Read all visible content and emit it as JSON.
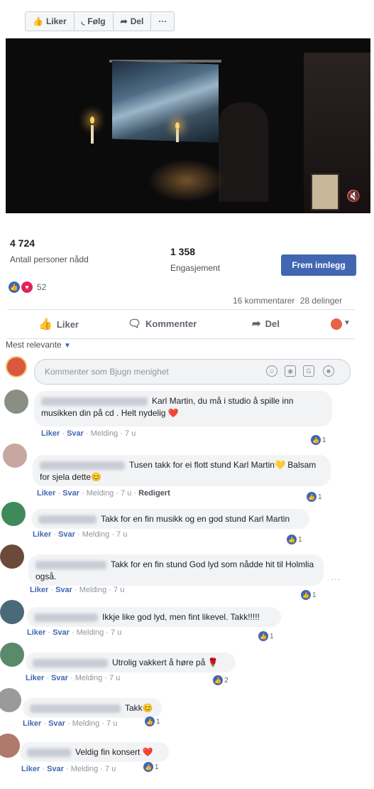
{
  "toolbar": {
    "like": "Liker",
    "follow": "Følg",
    "share": "Del",
    "more": "···"
  },
  "video": {
    "mute_icon": "speaker-muted-icon"
  },
  "stats": {
    "reach_num": "4 724",
    "reach_label": "Antall personer nådd",
    "eng_num": "1 358",
    "eng_label": "Engasjement",
    "boost": "Frem innlegg"
  },
  "reactions": {
    "count": "52",
    "comments": "16 kommentarer",
    "shares": "28 delinger"
  },
  "actions": {
    "like": "Liker",
    "comment": "Kommenter",
    "share": "Del"
  },
  "sort": {
    "label": "Mest relevante"
  },
  "composer": {
    "placeholder": "Kommenter som Bjugn menighet"
  },
  "comments": [
    {
      "text": "Karl Martin, du må i studio å spille inn musikken din på cd . Helt nydelig",
      "emoji": "❤️",
      "meta_like": "Liker",
      "meta_reply": "Svar",
      "meta_msg": "Melding",
      "time": "7 u",
      "extra": "",
      "rcount": "1"
    },
    {
      "text": "Tusen takk for ei flott stund Karl Martin",
      "emoji": "💛",
      "text2": "Balsam for sjela dette",
      "emoji2": "😊",
      "meta_like": "Liker",
      "meta_reply": "Svar",
      "meta_msg": "Melding",
      "time": "7 u",
      "extra": "Redigert",
      "rcount": "1"
    },
    {
      "text": "Takk for en fin musikk og en god stund Karl Martin",
      "meta_like": "Liker",
      "meta_reply": "Svar",
      "meta_msg": "Melding",
      "time": "7 u",
      "rcount": "1"
    },
    {
      "text": "Takk for en fin stund God lyd som nådde hit til Holmlia også.",
      "meta_like": "Liker",
      "meta_reply": "Svar",
      "meta_msg": "Melding",
      "time": "7 u",
      "rcount": "1"
    },
    {
      "text": "Ikkje like god lyd, men fint likevel. Takk!!!!!",
      "meta_like": "Liker",
      "meta_reply": "Svar",
      "meta_msg": "Melding",
      "time": "7 u",
      "rcount": "1"
    },
    {
      "text": "Utrolig vakkert å høre på",
      "emoji": "🌹",
      "meta_like": "Liker",
      "meta_reply": "Svar",
      "meta_msg": "Melding",
      "time": "7 u",
      "rcount": "2"
    },
    {
      "text": "Takk",
      "emoji": "😊",
      "meta_like": "Liker",
      "meta_reply": "Svar",
      "meta_msg": "Melding",
      "time": "7 u",
      "rcount": "1"
    },
    {
      "text": "Veldig fin konsert",
      "emoji": "❤️",
      "meta_like": "Liker",
      "meta_reply": "Svar",
      "meta_msg": "Melding",
      "time": "7 u",
      "rcount": "1"
    }
  ],
  "colors": {
    "accent": "#4267b2",
    "love": "#e0245e"
  }
}
